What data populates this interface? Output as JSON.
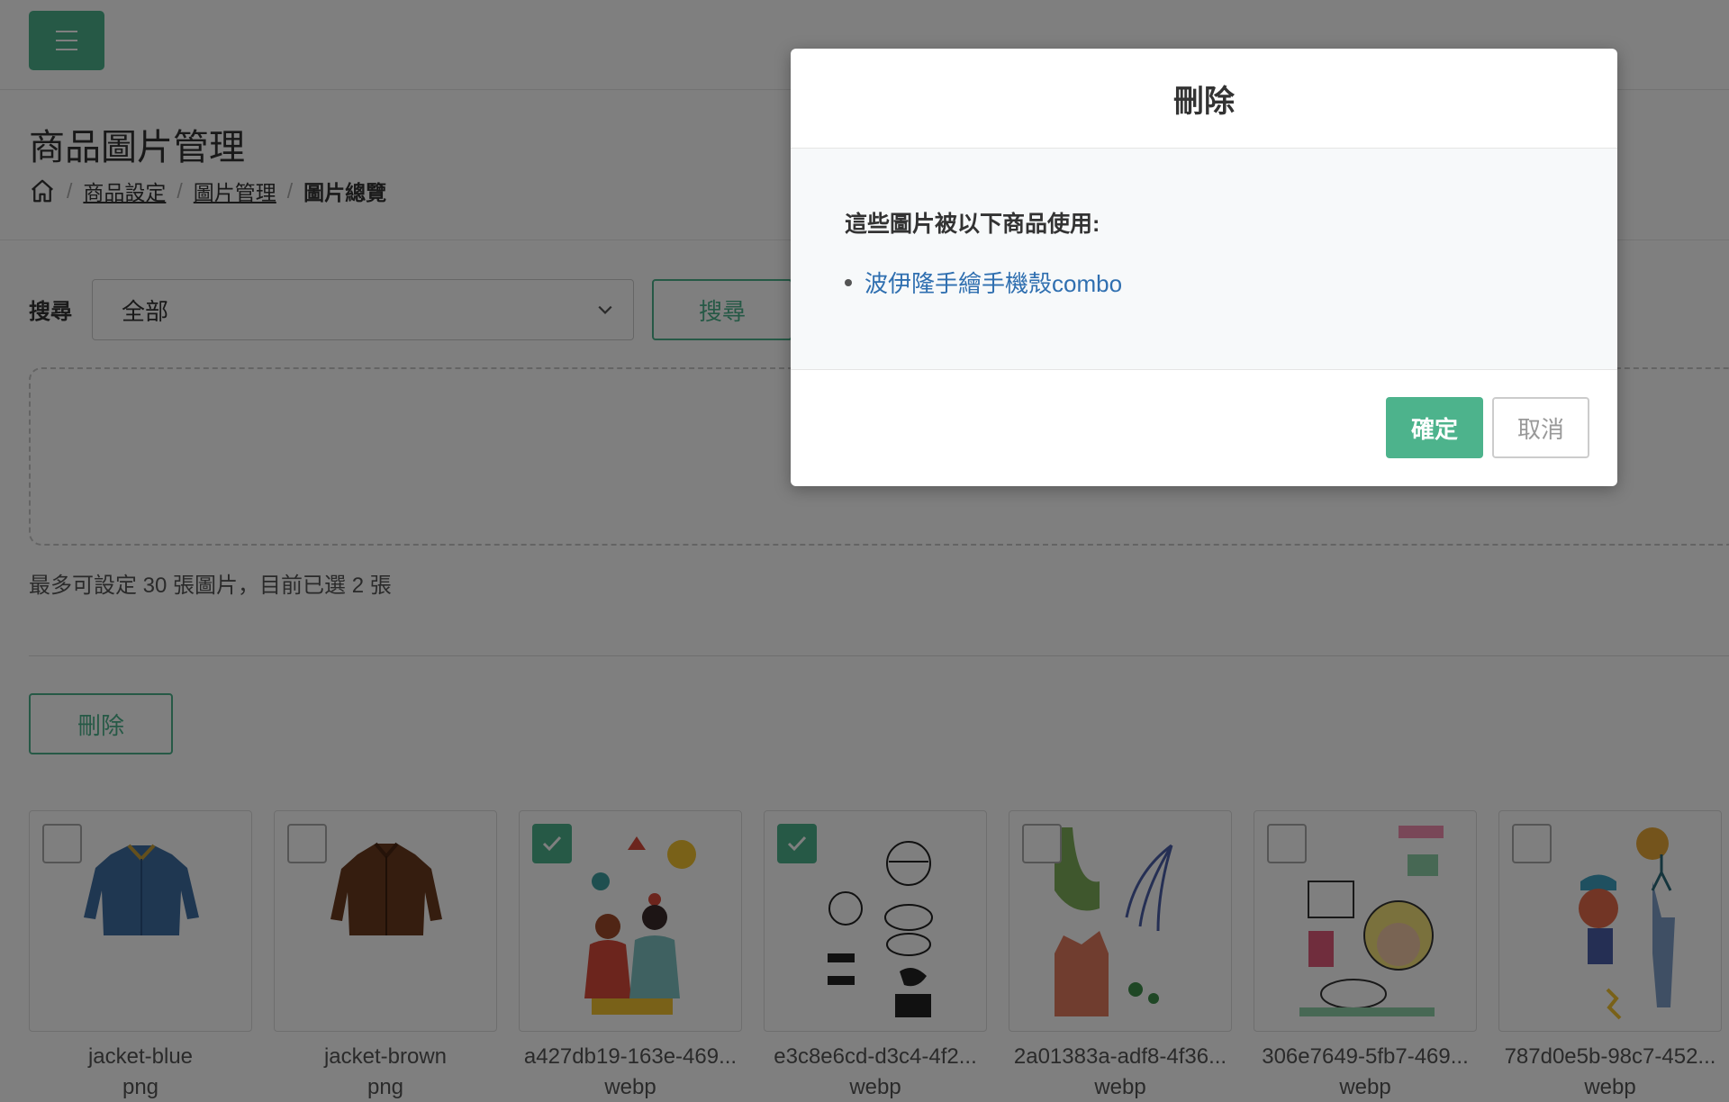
{
  "page": {
    "title": "商品圖片管理",
    "breadcrumb": [
      "商品設定",
      "圖片管理",
      "圖片總覽"
    ]
  },
  "search": {
    "label": "搜尋",
    "selected": "全部",
    "button": "搜尋"
  },
  "limit_text": "最多可設定 30 張圖片，目前已選 2 張",
  "delete_button": "刪除",
  "images": [
    {
      "name": "jacket-blue",
      "ext": "png",
      "checked": false
    },
    {
      "name": "jacket-brown",
      "ext": "png",
      "checked": false
    },
    {
      "name": "a427db19-163e-469...",
      "ext": "webp",
      "checked": true
    },
    {
      "name": "e3c8e6cd-d3c4-4f2...",
      "ext": "webp",
      "checked": true
    },
    {
      "name": "2a01383a-adf8-4f36...",
      "ext": "webp",
      "checked": false
    },
    {
      "name": "306e7649-5fb7-469...",
      "ext": "webp",
      "checked": false
    },
    {
      "name": "787d0e5b-98c7-452...",
      "ext": "webp",
      "checked": false
    }
  ],
  "modal": {
    "title": "刪除",
    "message": "這些圖片被以下商品使用:",
    "products": [
      "波伊隆手繪手機殼combo"
    ],
    "confirm": "確定",
    "cancel": "取消"
  },
  "colors": {
    "accent": "#4db38c",
    "link": "#2f6fb0"
  }
}
